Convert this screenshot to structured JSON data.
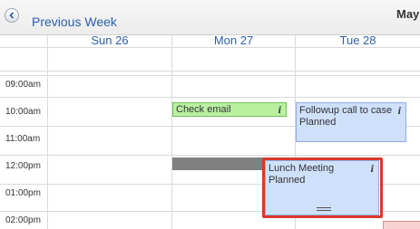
{
  "header": {
    "prev_label": "Previous Week",
    "month_label": "May"
  },
  "days": [
    {
      "label": "Sun 26"
    },
    {
      "label": "Mon 27"
    },
    {
      "label": "Tue 28"
    }
  ],
  "times": [
    "09:00am",
    "10:00am",
    "11:00am",
    "12:00pm",
    "01:00pm",
    "02:00pm"
  ],
  "events": {
    "check_email": {
      "title": "Check email",
      "info": "i"
    },
    "followup": {
      "title": "Followup call to case",
      "status": "Planned",
      "info": "i"
    },
    "lunch": {
      "title": "Lunch Meeting",
      "status": "Planned",
      "info": "i"
    }
  },
  "colors": {
    "link": "#2b5fa8",
    "event_blue": "#cfe0fb",
    "event_green": "#b8f0a0",
    "highlight": "#d93a2b",
    "busy_gray": "#808080"
  },
  "icons": {
    "prev": "chevron-left-icon",
    "info": "info-icon",
    "resize": "resize-handle-icon"
  }
}
